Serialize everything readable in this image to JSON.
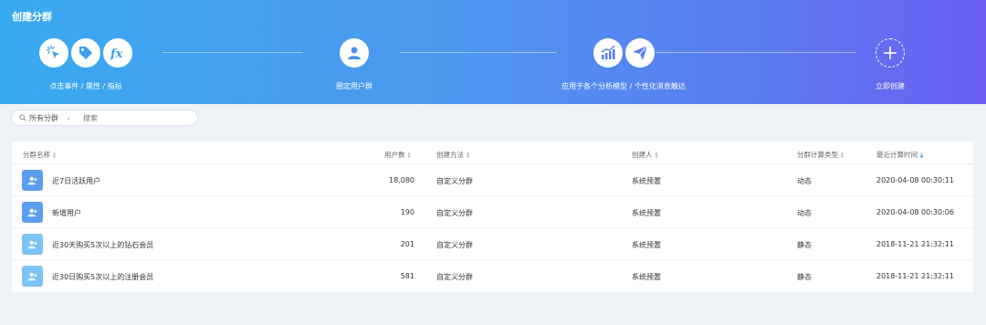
{
  "banner": {
    "title": "创建分群",
    "steps": [
      {
        "label": "点击事件 / 属性 / 指标",
        "icons": [
          "click-icon",
          "tag-icon",
          "fx-icon"
        ]
      },
      {
        "label": "圈定用户群",
        "icons": [
          "users-icon"
        ]
      },
      {
        "label": "应用于各个分析模型 / 个性化消息触达",
        "icons": [
          "chart-icon",
          "send-icon"
        ]
      },
      {
        "label": "立即创建",
        "icons": [
          "plus-icon"
        ]
      }
    ]
  },
  "filter": {
    "select_label": "所有分群",
    "search_placeholder": "搜索"
  },
  "table": {
    "columns": {
      "name": "分群名称",
      "users": "用户数",
      "method": "创建方法",
      "creator": "创建人",
      "calc_type": "分群计算类型",
      "last_calc": "最近计算时间"
    },
    "rows": [
      {
        "name": "近7日活跃用户",
        "users": "18,080",
        "method": "自定义分群",
        "creator": "系统预置",
        "calc_type": "动态",
        "last_calc": "2020-04-08 00:30:11",
        "avatar_color": "#5b9ef0"
      },
      {
        "name": "新增用户",
        "users": "190",
        "method": "自定义分群",
        "creator": "系统预置",
        "calc_type": "动态",
        "last_calc": "2020-04-08 00:30:06",
        "avatar_color": "#5b9ef0"
      },
      {
        "name": "近30天购买5次以上的钻石会员",
        "users": "201",
        "method": "自定义分群",
        "creator": "系统预置",
        "calc_type": "静态",
        "last_calc": "2018-11-21 21:32:11",
        "avatar_color": "#7cc4f5"
      },
      {
        "name": "近30日购买5次以上的注册会员",
        "users": "581",
        "method": "自定义分群",
        "creator": "系统预置",
        "calc_type": "静态",
        "last_calc": "2018-11-21 21:32:11",
        "avatar_color": "#7cc4f5"
      }
    ]
  }
}
